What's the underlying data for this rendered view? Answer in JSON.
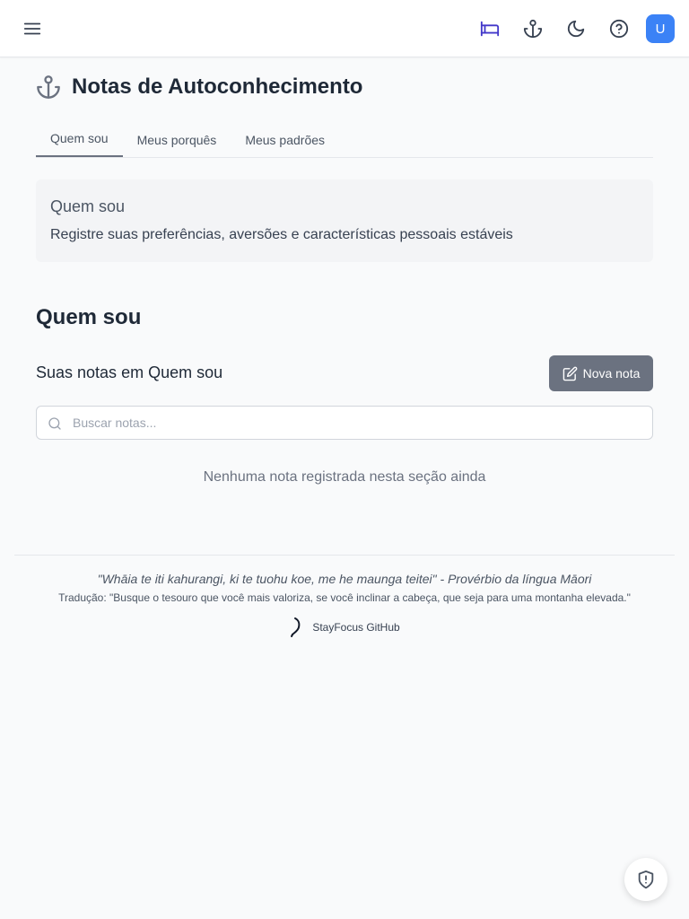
{
  "header": {
    "menu_icon": "menu-icon",
    "bed_icon": "bed-icon",
    "anchor_icon": "anchor-icon",
    "theme_icon": "moon-icon",
    "help_icon": "help-circle-icon",
    "avatar_initial": "U",
    "active_color": "#4338ca",
    "avatar_color": "#3b82f6"
  },
  "page": {
    "title": "Notas de Autoconhecimento",
    "title_icon": "anchor-icon"
  },
  "tabs": [
    {
      "label": "Quem sou",
      "active": true
    },
    {
      "label": "Meus porquês",
      "active": false
    },
    {
      "label": "Meus padrões",
      "active": false
    }
  ],
  "info_card": {
    "title": "Quem sou",
    "description": "Registre suas preferências, aversões e características pessoais estáveis"
  },
  "section": {
    "title": "Quem sou",
    "notes_heading": "Suas notas em Quem sou",
    "new_note_label": "Nova nota",
    "search_placeholder": "Buscar notas...",
    "empty_message": "Nenhuma nota registrada nesta seção ainda"
  },
  "footer": {
    "quote": "\"Whāia te iti kahurangi, ki te tuohu koe, me he maunga teitei\" - Provérbio da língua Māori",
    "translation": "Tradução: \"Busque o tesouro que você mais valoriza, se você inclinar a cabeça, que seja para uma montanha elevada.\"",
    "link_label": "StayFocus GitHub"
  },
  "fab": {
    "icon": "shield-alert-icon"
  }
}
